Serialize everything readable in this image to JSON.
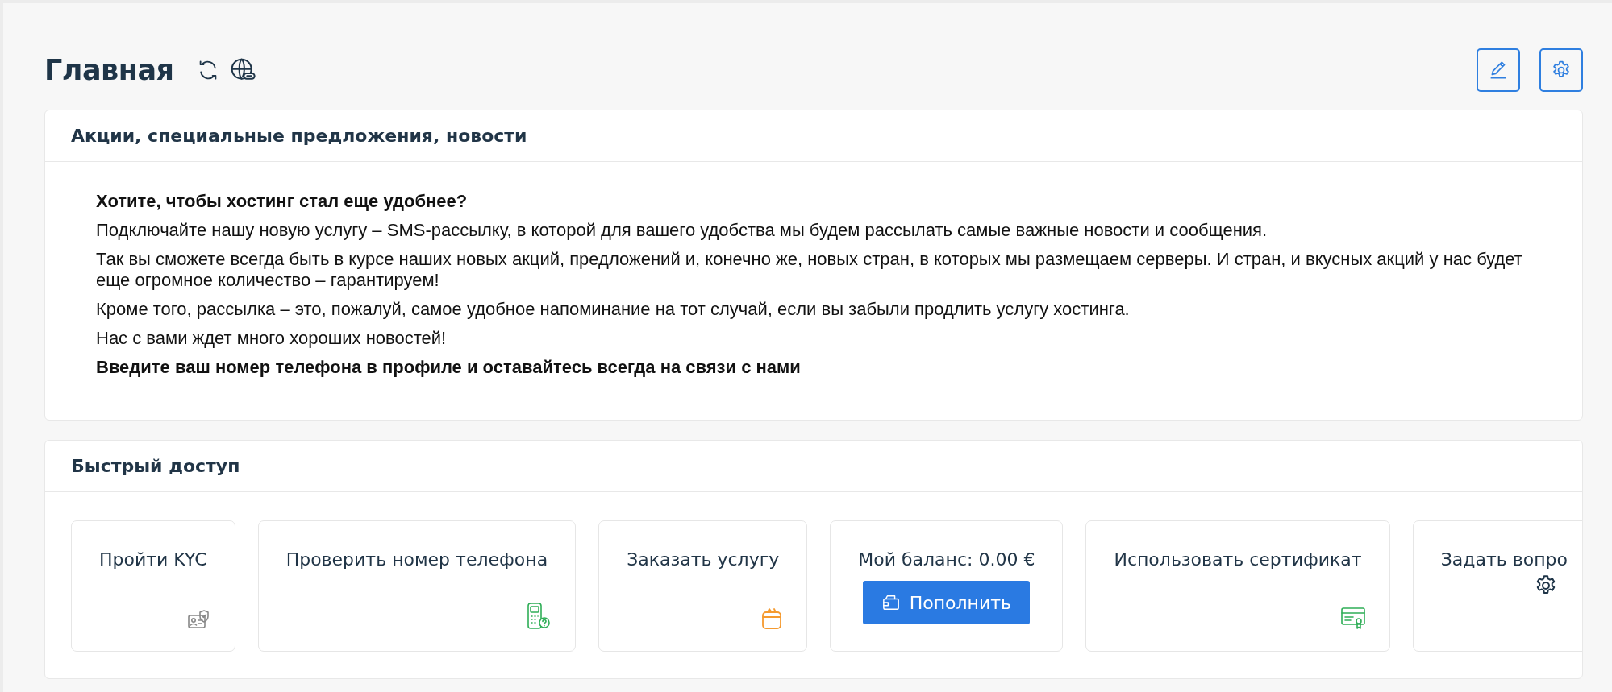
{
  "page": {
    "title": "Главная"
  },
  "news": {
    "title": "Акции, специальные предложения, новости",
    "paragraphs": [
      {
        "kind": "bold",
        "text": "Хотите, чтобы хостинг стал еще удобнее?"
      },
      {
        "kind": "plain",
        "text": "Подключайте нашу новую услугу – SMS-рассылку, в которой для вашего удобства мы будем рассылать самые важные новости и сообщения."
      },
      {
        "kind": "plain",
        "text": "Так вы сможете всегда быть в курсе наших новых акций, предложений и, конечно же, новых стран, в которых мы размещаем серверы. И стран, и вкусных акций у нас будет еще огромное количество – гарантируем!"
      },
      {
        "kind": "plain",
        "text": "Кроме того, рассылка – это, пожалуй, самое удобное напоминание на тот случай, если вы забыли продлить услугу хостинга."
      },
      {
        "kind": "plain",
        "text": "Нас с вами ждет много хороших новостей!"
      },
      {
        "kind": "bold",
        "text": "Введите ваш номер телефона в профиле и оставайтесь всегда на связи с нами"
      }
    ]
  },
  "quick_access": {
    "title": "Быстрый доступ",
    "items": [
      {
        "kind": "kyc",
        "label": "Пройти KYC"
      },
      {
        "kind": "phone",
        "label": "Проверить номер телефона"
      },
      {
        "kind": "order",
        "label": "Заказать услугу"
      },
      {
        "kind": "balance",
        "label": "Мой баланс: 0.00 €",
        "button": "Пополнить"
      },
      {
        "kind": "certificate",
        "label": "Использовать сертификат"
      },
      {
        "kind": "question",
        "label": "Задать вопро"
      }
    ]
  }
}
